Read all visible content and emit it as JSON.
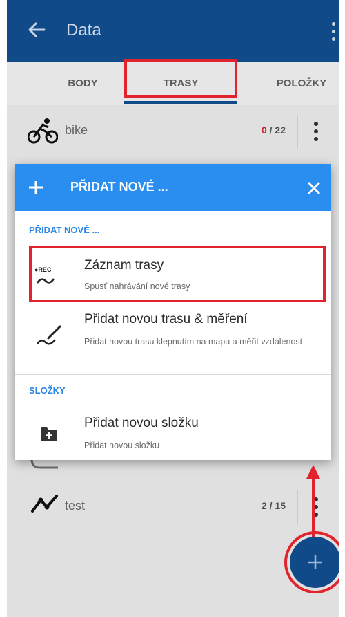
{
  "appbar": {
    "title": "Data"
  },
  "tabs": [
    {
      "label": "BODY"
    },
    {
      "label": "TRASY"
    },
    {
      "label": "POLOŽKY"
    }
  ],
  "list": [
    {
      "name": "bike",
      "count_highlight": "0",
      "count_rest": " / 22",
      "icon": "bike-icon"
    },
    {
      "name": "test",
      "count": "2 / 15",
      "icon": "track-icon"
    }
  ],
  "dialog": {
    "title": "PŘIDAT NOVÉ ...",
    "sections": [
      {
        "label": "PŘIDAT NOVÉ ...",
        "items": [
          {
            "title": "Záznam trasy",
            "subtitle": "Spusť nahrávání nové trasy",
            "icon": "record-track-icon",
            "icon_text": "●REC"
          },
          {
            "title": "Přidat novou trasu & měření",
            "subtitle": "Přidat novou trasu klepnutím na mapu a měřit vzdálenost",
            "icon": "draw-track-icon"
          }
        ]
      },
      {
        "label": "SLOŽKY",
        "items": [
          {
            "title": "Přidat novou složku",
            "subtitle": "Přidat novou složku",
            "icon": "add-folder-icon"
          }
        ]
      }
    ]
  },
  "colors": {
    "appbar": "#114a88",
    "dialog_header": "#2a8df0",
    "accent_text": "#2a86e6",
    "highlight": "#e0232c",
    "count_red": "#d0282e"
  }
}
